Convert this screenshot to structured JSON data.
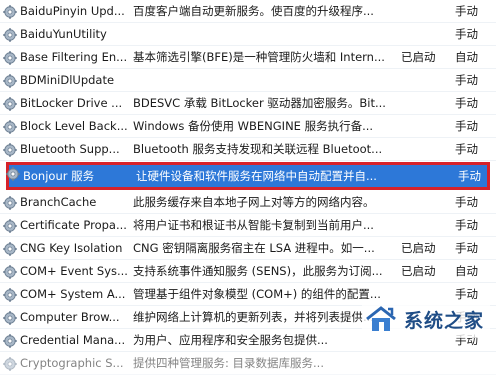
{
  "services": {
    "rows": [
      {
        "name": "BaiduPinyin Upd...",
        "desc": "百度客户端自动更新服务。使百度的升级程序...",
        "status": "",
        "startup": "手动"
      },
      {
        "name": "BaiduYunUtility",
        "desc": "",
        "status": "",
        "startup": "手动"
      },
      {
        "name": "Base Filtering En...",
        "desc": "基本筛选引擎(BFE)是一种管理防火墙和 Intern...",
        "status": "已启动",
        "startup": "自动"
      },
      {
        "name": "BDMiniDlUpdate",
        "desc": "",
        "status": "",
        "startup": "手动"
      },
      {
        "name": "BitLocker Drive ...",
        "desc": "BDESVC 承载 BitLocker 驱动器加密服务。Bit...",
        "status": "",
        "startup": "手动"
      },
      {
        "name": "Block Level Back...",
        "desc": "Windows 备份使用 WBENGINE 服务执行备...",
        "status": "",
        "startup": "手动"
      },
      {
        "name": "Bluetooth Supp...",
        "desc": "Bluetooth 服务支持发现和关联远程 Bluetoot...",
        "status": "",
        "startup": "手动"
      },
      {
        "name": "Bonjour 服务",
        "desc": "让硬件设备和软件服务在网络中自动配置并自...",
        "status": "",
        "startup": "手动",
        "selected": true
      },
      {
        "name": "BranchCache",
        "desc": "此服务缓存来自本地子网上对等方的网络内容。",
        "status": "",
        "startup": "手动"
      },
      {
        "name": "Certificate Propa...",
        "desc": "将用户证书和根证书从智能卡复制到当前用户...",
        "status": "",
        "startup": "手动"
      },
      {
        "name": "CNG Key Isolation",
        "desc": "CNG 密钥隔离服务宿主在 LSA 进程中。如一...",
        "status": "已启动",
        "startup": "手动"
      },
      {
        "name": "COM+ Event Sys...",
        "desc": "支持系统事件通知服务 (SENS)，此服务为订阅...",
        "status": "已启动",
        "startup": "自动"
      },
      {
        "name": "COM+ System A...",
        "desc": "管理基于组件对象模型 (COM+) 的组件的配置...",
        "status": "",
        "startup": "手动"
      },
      {
        "name": "Computer Brow...",
        "desc": "维护网络上计算机的更新列表，并将列表提供...",
        "status": "",
        "startup": "手动"
      },
      {
        "name": "Credential Mana...",
        "desc": "为用户、应用程序和安全服务包提供...",
        "status": "",
        "startup": "手动"
      },
      {
        "name": "Cryptographic S...",
        "desc": "提供四种管理服务: 目录数据库服务...",
        "status": "",
        "startup": ""
      }
    ]
  },
  "watermark": {
    "text": "系统之家"
  }
}
